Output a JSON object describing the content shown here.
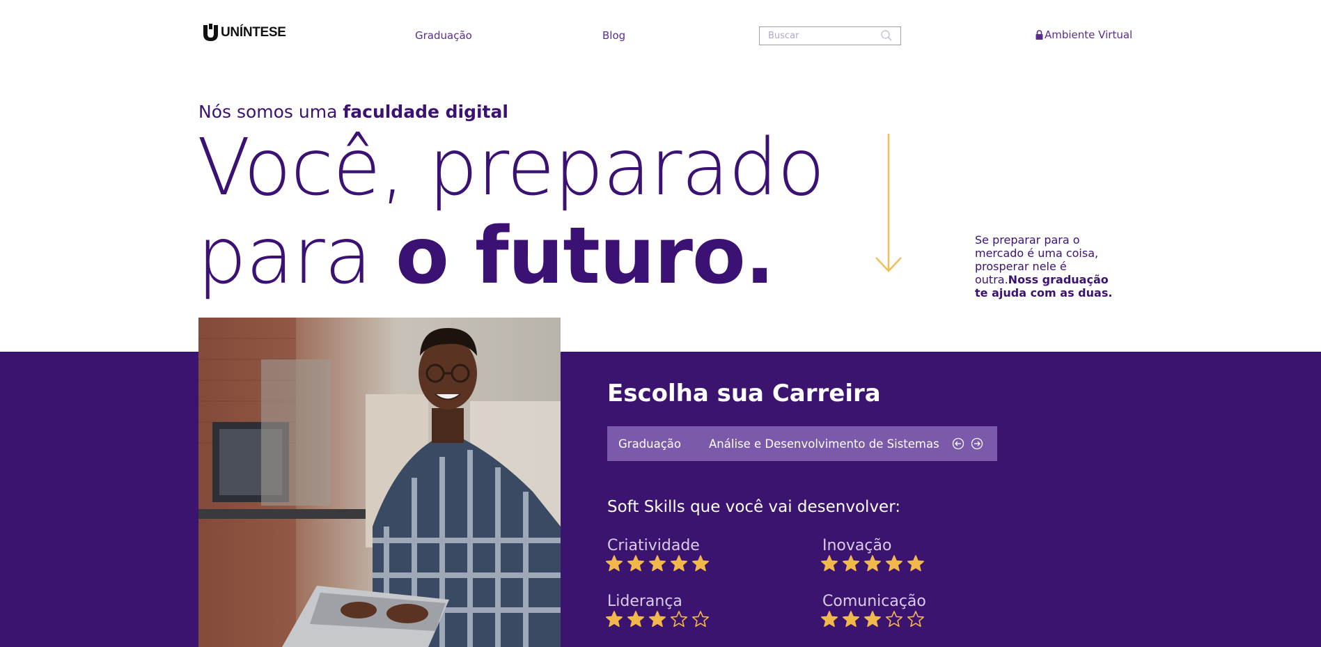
{
  "header": {
    "logo_text": "UNÍNTESE",
    "nav": [
      {
        "label": "Graduação"
      },
      {
        "label": "Blog"
      }
    ],
    "search": {
      "placeholder": "Buscar",
      "value": ""
    },
    "virtual_label": "Ambiente Virtual",
    "icons": {
      "search": "search-icon",
      "lock": "lock-icon"
    }
  },
  "hero": {
    "subtitle_plain": "Nós somos uma ",
    "subtitle_bold": "faculdade digital",
    "line1": "Você, preparado",
    "line2_plain": "para ",
    "line2_bold": "o futuro.",
    "side_plain": "Se preparar para o mercado é uma coisa, prosperar nele é outra.",
    "side_bold": "Noss graduação te ajuda com as duas."
  },
  "career": {
    "title": "Escolha sua Carreira",
    "tab": "Graduação",
    "course": "Análise e Desenvolvimento de Sistemas",
    "icons": {
      "prev": "arrow-left-circle-icon",
      "next": "arrow-right-circle-icon"
    }
  },
  "skills": {
    "title": "Soft Skills que você vai desenvolver:",
    "items": [
      {
        "name": "Criatividade",
        "rating": 5,
        "max": 5
      },
      {
        "name": "Inovação",
        "rating": 5,
        "max": 5
      },
      {
        "name": "Liderança",
        "rating": 3,
        "max": 5
      },
      {
        "name": "Comunicação",
        "rating": 3,
        "max": 5
      }
    ]
  },
  "colors": {
    "brand_purple": "#3b1470",
    "text_purple": "#3b1273",
    "bar_purple": "#7b5aab",
    "star_gold": "#f2b84b",
    "arrow_gold": "#f0bf55"
  }
}
